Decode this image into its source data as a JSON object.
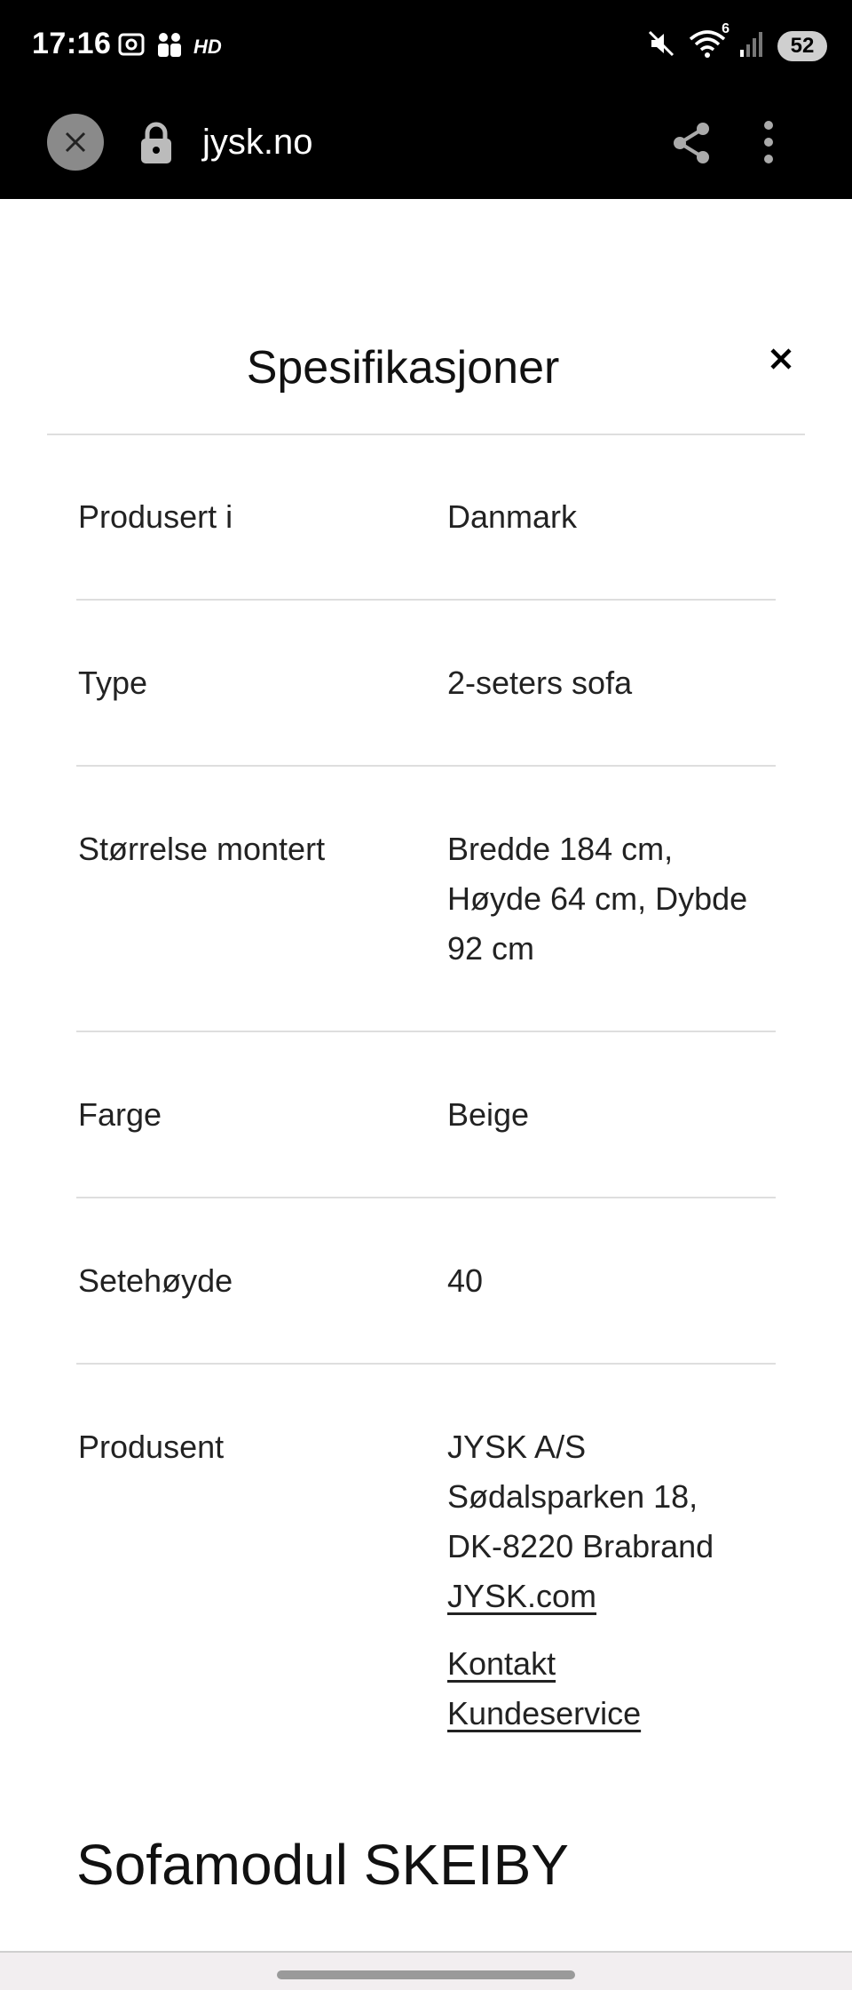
{
  "status_bar": {
    "time": "17:16",
    "left_icons": [
      "screenshot-icon",
      "people-icon",
      "hd-icon"
    ],
    "hd_label": "HD",
    "right_icons": [
      "mute-icon",
      "wifi-icon",
      "signal-icon"
    ],
    "wifi_badge": "6",
    "battery": "52"
  },
  "browser": {
    "url": "jysk.no",
    "icons": [
      "close-icon",
      "lock-icon",
      "share-icon",
      "more-vert-icon"
    ]
  },
  "modal": {
    "title": "Spesifikasjoner",
    "close_icon": "close-icon"
  },
  "specs": [
    {
      "label": "Produsert i",
      "value": "Danmark"
    },
    {
      "label": "Type",
      "value": "2-seters sofa"
    },
    {
      "label": "Størrelse montert",
      "value_lines": [
        "Bredde 184 cm,",
        "Høyde 64 cm, Dybde",
        "92 cm"
      ]
    },
    {
      "label": "Farge",
      "value": "Beige"
    },
    {
      "label": "Setehøyde",
      "value": "40"
    },
    {
      "label": "Produsent",
      "value_lines": [
        "JYSK A/S",
        "Sødalsparken 18,",
        "DK-8220 Brabrand"
      ],
      "link_site": "JYSK.com",
      "link_contact": [
        "Kontakt",
        "Kundeservice"
      ]
    }
  ],
  "next_section_heading": "Sofamodul SKEIBY",
  "colors": {
    "system_bar": "#000000",
    "page_background": "#ffffff",
    "divider": "#dedede",
    "text": "#222222"
  }
}
